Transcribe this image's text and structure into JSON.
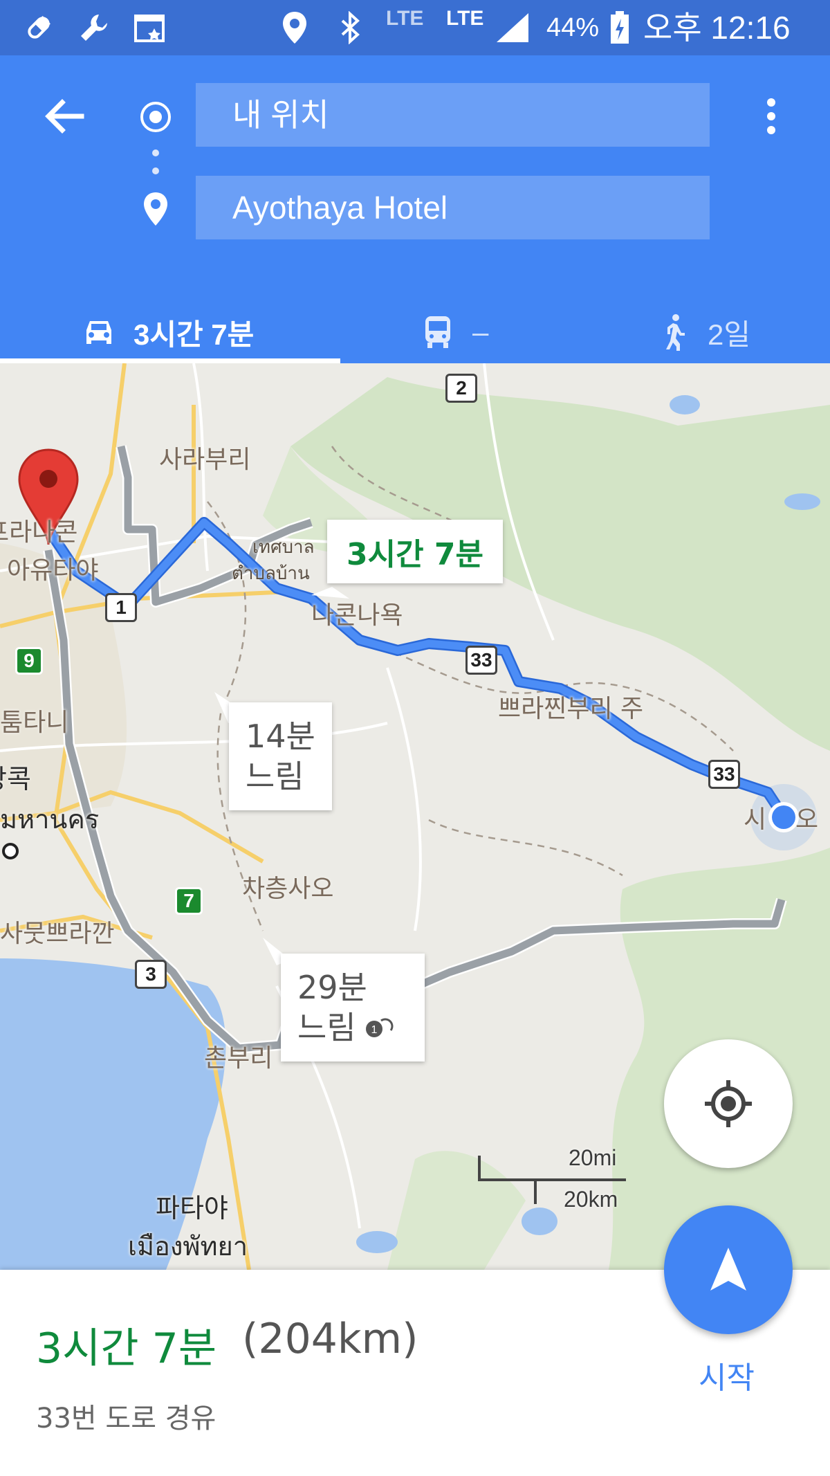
{
  "status_bar": {
    "battery": "44%",
    "time": "오후 12:16",
    "network_1": "LTE",
    "network_2": "LTE"
  },
  "header": {
    "origin": "내 위치",
    "destination": "Ayothaya Hotel",
    "tabs": [
      {
        "mode": "car-icon",
        "label": "3시간 7분"
      },
      {
        "mode": "transit-icon",
        "label": "–"
      },
      {
        "mode": "walk-icon",
        "label": "2일"
      }
    ],
    "accent_color": "#4285f4"
  },
  "map": {
    "labels": [
      "사라부리",
      "เทศบาล",
      "ตำบลบ้าน",
      "나콘나욕",
      "쁘라찐부리 주",
      "프라나콘",
      "아유타야",
      "툼타니",
      "방콕",
      "มหานคร",
      "차층사오",
      "사뭇쁘라깐",
      "촌부리",
      "파타야",
      "เมืองพัทยา",
      "시",
      "오"
    ],
    "route_shields": [
      "2",
      "1",
      "33",
      "33",
      "3"
    ],
    "green_shields": [
      "9",
      "7"
    ],
    "callouts": {
      "primary": "3시간 7분",
      "alt_1_line1": "14분",
      "alt_1_line2": "느림",
      "alt_2_line1": "29분",
      "alt_2_line2": "느림"
    },
    "scale_mi": "20mi",
    "scale_km": "20km",
    "route_color": "#4285f4",
    "alt_route_color": "#9aa0a6"
  },
  "bottom": {
    "duration": "3시간 7분",
    "distance": "(204km)",
    "via": "33번 도로 경유",
    "start_label": "시작"
  }
}
